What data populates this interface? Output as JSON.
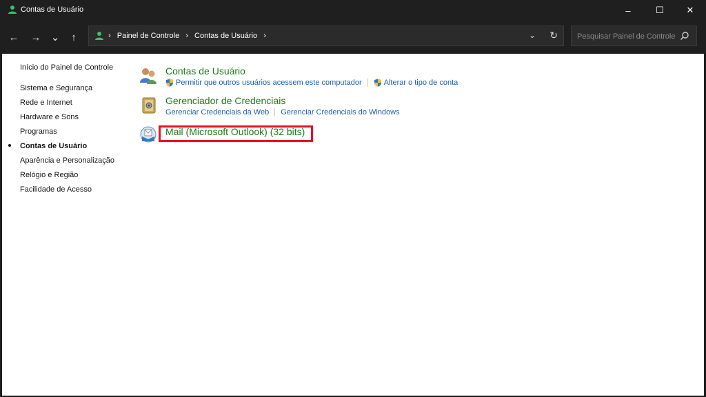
{
  "window": {
    "title": "Contas de Usuário",
    "controls": {
      "minimize": "–",
      "maximize": "☐",
      "close": "✕"
    }
  },
  "nav_buttons": {
    "back": "←",
    "forward": "→",
    "recent": "⌄",
    "up": "↑"
  },
  "address": {
    "crumbs": [
      "Painel de Controle",
      "Contas de Usuário"
    ],
    "separator": "›",
    "dropdown": "⌄",
    "refresh": "↻"
  },
  "search": {
    "placeholder": "Pesquisar Painel de Controle"
  },
  "sidebar": {
    "items": [
      {
        "label": "Início do Painel de Controle",
        "active": false
      },
      {
        "label": "Sistema e Segurança",
        "active": false
      },
      {
        "label": "Rede e Internet",
        "active": false
      },
      {
        "label": "Hardware e Sons",
        "active": false
      },
      {
        "label": "Programas",
        "active": false
      },
      {
        "label": "Contas de Usuário",
        "active": true
      },
      {
        "label": "Aparência e Personalização",
        "active": false
      },
      {
        "label": "Relógio e Região",
        "active": false
      },
      {
        "label": "Facilidade de Acesso",
        "active": false
      }
    ]
  },
  "categories": [
    {
      "title": "Contas de Usuário",
      "icon": "users-icon",
      "links": [
        "Permitir que outros usuários acessem este computador",
        "Alterar o tipo de conta"
      ]
    },
    {
      "title": "Gerenciador de Credenciais",
      "icon": "credential-vault-icon",
      "links": [
        "Gerenciar Credenciais da Web",
        "Gerenciar Credenciais do Windows"
      ]
    },
    {
      "title": "Mail (Microsoft Outlook) (32 bits)",
      "icon": "mail-icon",
      "links": []
    }
  ],
  "colors": {
    "titlebar": "#1f1f1f",
    "category_title": "#1c7a1c",
    "link": "#1a5fb4",
    "highlight": "#e81123"
  }
}
